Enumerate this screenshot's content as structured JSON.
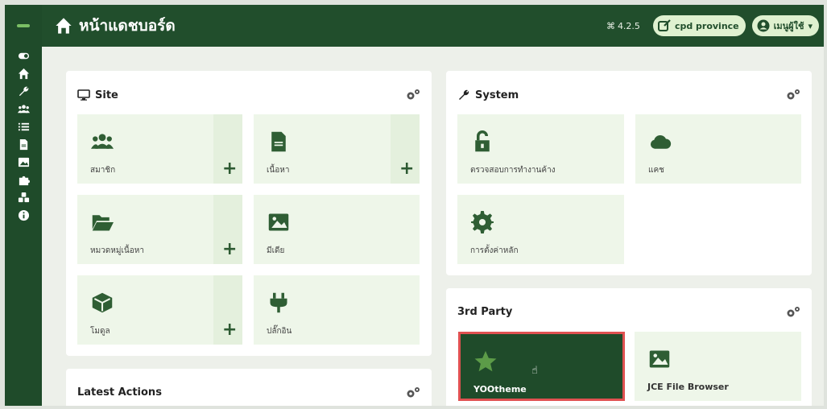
{
  "topbar": {
    "title": "หน้าแดชบอร์ด",
    "version": "4.2.5",
    "site_button": "cpd province",
    "user_menu": "เมนูผู้ใช้"
  },
  "sidebar": {
    "icons": [
      "toggle-icon",
      "home-icon",
      "wrench-icon",
      "users-icon",
      "list-icon",
      "file-icon",
      "image-icon",
      "puzzle-icon",
      "cubes-icon",
      "info-icon"
    ]
  },
  "site": {
    "title": "Site",
    "tiles": [
      {
        "label": "สมาชิก",
        "icon": "users-icon"
      },
      {
        "label": "เนื้อหา",
        "icon": "file-icon"
      },
      {
        "label": "หมวดหมู่เนื้อหา",
        "icon": "folder-icon"
      },
      {
        "label": "มีเดีย",
        "icon": "image-icon"
      },
      {
        "label": "โมดูล",
        "icon": "cube-icon"
      },
      {
        "label": "ปลั๊กอิน",
        "icon": "plug-icon"
      }
    ],
    "add_label": "+"
  },
  "system": {
    "title": "System",
    "tiles": [
      {
        "label": "ตรวจสอบการทำงานค้าง",
        "icon": "unlock-icon"
      },
      {
        "label": "แคช",
        "icon": "cloud-icon"
      },
      {
        "label": "การตั้งค่าหลัก",
        "icon": "gear-icon"
      }
    ]
  },
  "third_party": {
    "title": "3rd Party",
    "tiles": [
      {
        "label": "YOOtheme",
        "icon": "star-icon"
      },
      {
        "label": "JCE File Browser",
        "icon": "image-icon"
      }
    ]
  },
  "latest": {
    "title": "Latest Actions"
  },
  "colors": {
    "sidebar": "#1f4b2a",
    "accent": "#214e2c",
    "tile": "#eef6e9",
    "highlight_border": "#e05151"
  }
}
